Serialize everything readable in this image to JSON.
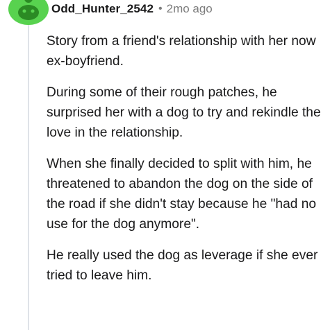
{
  "comment": {
    "username": "Odd_Hunter_2542",
    "separator": "•",
    "timestamp": "2mo ago",
    "avatar_icon": "snoo-avatar-icon",
    "avatar_color": "#58d24f",
    "paragraphs": [
      "Story from a friend's relationship with her now ex-boyfriend.",
      "During some of their rough patches, he surprised her with a dog to try and rekindle the love in the relationship.",
      "When she finally decided to split with him, he threatened to abandon the dog on the side of the road if she didn't stay because he \"had no use for the dog anymore\".",
      "He really used the dog as leverage if she ever tried to leave him."
    ]
  }
}
